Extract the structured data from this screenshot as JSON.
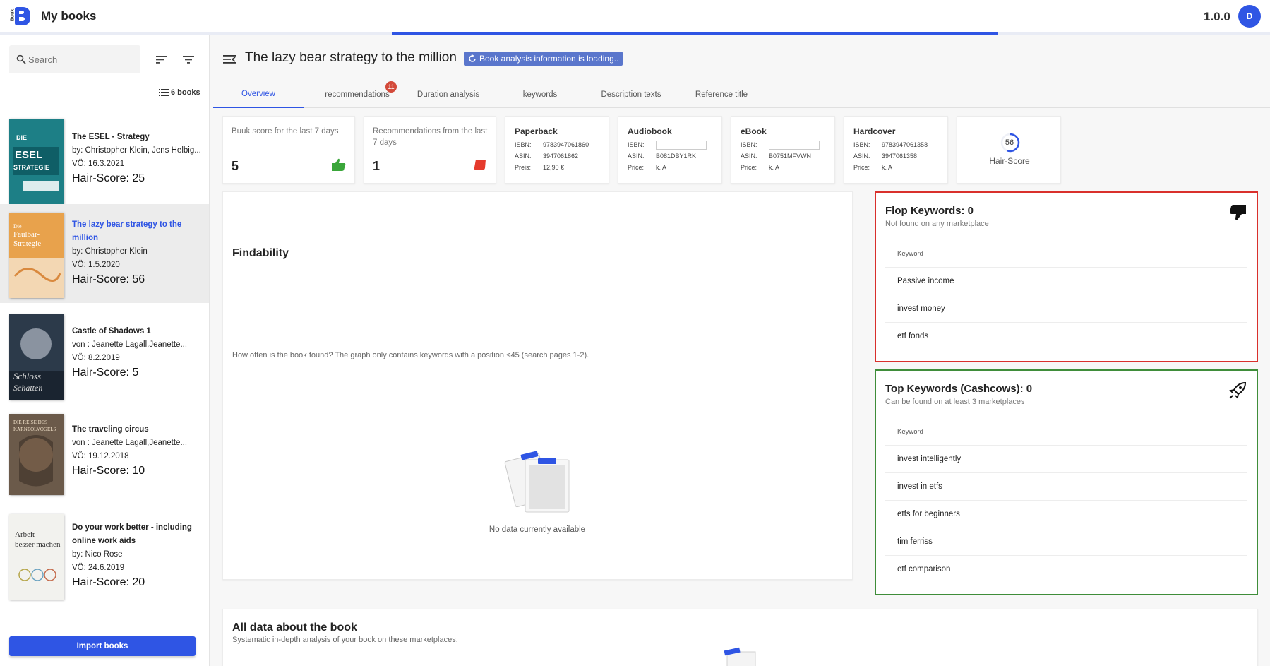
{
  "header": {
    "logo_text": "Buuk",
    "app_title": "My books",
    "version": "1.0.0",
    "avatar_initial": "D"
  },
  "sidebar": {
    "search_placeholder": "Search",
    "book_count": "6 books",
    "import_label": "Import books",
    "books": [
      {
        "title": "The ESEL - Strategy",
        "authors": "by: Christopher Klein, Jens Helbig...",
        "date": "VÖ: 16.3.2021",
        "score": "Hair-Score: 25",
        "cover_color": "#1d7f86",
        "cover_text": "ESEL STRATEGIE"
      },
      {
        "title": "The lazy bear strategy to the million",
        "authors": "by: Christopher Klein",
        "date": "VÖ: 1.5.2020",
        "score": "Hair-Score: 56",
        "cover_color": "#e8a24c",
        "cover_text": "Faulbär-Strategie"
      },
      {
        "title": "Castle of Shadows 1",
        "authors": "von : Jeanette Lagall,Jeanette...",
        "date": "VÖ: 8.2.2019",
        "score": "Hair-Score: 5",
        "cover_color": "#2c3a4a",
        "cover_text": "Schloss der Schatten"
      },
      {
        "title": "The traveling circus",
        "authors": "von : Jeanette Lagall,Jeanette...",
        "date": "VÖ: 19.12.2018",
        "score": "Hair-Score: 10",
        "cover_color": "#6b5a4a",
        "cover_text": "DIE REISE DES KARNEOLVOGELS"
      },
      {
        "title": "Do your work better - including online work aids",
        "authors": "by: Nico Rose",
        "date": "VÖ: 24.6.2019",
        "score": "Hair-Score: 20",
        "cover_color": "#f2f2ee",
        "cover_text": "Arbeit besser machen"
      }
    ]
  },
  "main": {
    "book_title": "The lazy bear strategy to the million",
    "loading_badge": "Book analysis information is loading..",
    "tabs": [
      {
        "label": "Overview",
        "active": true
      },
      {
        "label": "recommendations",
        "badge": "11"
      },
      {
        "label": "Duration analysis"
      },
      {
        "label": "keywords"
      },
      {
        "label": "Description texts"
      },
      {
        "label": "Reference title"
      }
    ],
    "metrics": [
      {
        "label": "Buuk score for the last 7 days",
        "value": "5",
        "icon": "thumbs-up-icon"
      },
      {
        "label": "Recommendations from the last 7 days",
        "value": "1",
        "icon": "flag-icon"
      }
    ],
    "formats": [
      {
        "title": "Paperback",
        "rows": [
          [
            "ISBN:",
            "9783947061860"
          ],
          [
            "ASIN:",
            "3947061862"
          ],
          [
            "Preis:",
            "12,90 €"
          ]
        ]
      },
      {
        "title": "Audiobook",
        "rows": [
          [
            "ISBN:",
            ""
          ],
          [
            "ASIN:",
            "B081DBY1RK"
          ],
          [
            "Price:",
            "k. A"
          ]
        ]
      },
      {
        "title": "eBook",
        "rows": [
          [
            "ISBN:",
            ""
          ],
          [
            "ASIN:",
            "B0751MFVWN"
          ],
          [
            "Price:",
            "k. A"
          ]
        ]
      },
      {
        "title": "Hardcover",
        "rows": [
          [
            "ISBN:",
            "9783947061358"
          ],
          [
            "ASIN:",
            "3947061358"
          ],
          [
            "Price:",
            "k. A"
          ]
        ]
      }
    ],
    "hair_score": {
      "value": "56",
      "fraction": 0.56,
      "label": "Hair-Score"
    },
    "findability": {
      "title": "Findability",
      "description": "How often is the book found? The graph only contains keywords with a position <45 (search pages 1-2).",
      "empty": "No data currently available"
    },
    "flop_keywords": {
      "title": "Flop Keywords: 0",
      "subtitle": "Not found on any marketplace",
      "header": "Keyword",
      "items": [
        "Passive income",
        "invest money",
        "etf fonds"
      ]
    },
    "top_keywords": {
      "title": "Top Keywords (Cashcows): 0",
      "subtitle": "Can be found on at least 3 marketplaces",
      "header": "Keyword",
      "items": [
        "invest intelligently",
        "invest in etfs",
        "etfs for beginners",
        "tim ferriss",
        "etf comparison"
      ]
    },
    "all_data": {
      "title": "All data about the book",
      "subtitle": "Systematic in-depth analysis of your book on these marketplaces."
    }
  },
  "colors": {
    "primary": "#2f55e4",
    "flop_border": "#d9302c",
    "top_border": "#3f8d3a",
    "thumbs_up": "#3aa63a",
    "flag": "#e53a2c"
  }
}
